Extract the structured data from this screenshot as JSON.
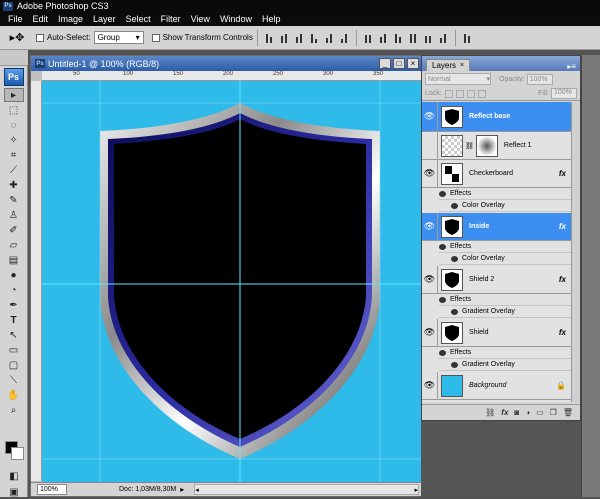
{
  "app": {
    "title": "Adobe Photoshop CS3",
    "logo": "Ps"
  },
  "menu": [
    "File",
    "Edit",
    "Image",
    "Layer",
    "Select",
    "Filter",
    "View",
    "Window",
    "Help"
  ],
  "options": {
    "auto_select_label": "Auto-Select:",
    "auto_select_value": "Group",
    "transform_label": "Show Transform Controls"
  },
  "document": {
    "title": "Untitled-1 @ 100% (RGB/8)",
    "ruler_marks": [
      "50",
      "100",
      "150",
      "200",
      "250",
      "300",
      "350"
    ],
    "canvas_color": "#2ebbea",
    "zoom": "100%",
    "doc_info": "Doc: 1,03M/8,30M"
  },
  "layers_panel": {
    "tab_label": "Layers",
    "tab_close": "×",
    "blend_mode": "Normal",
    "opacity_label": "Opacity:",
    "opacity_value": "100%",
    "lock_label": "Lock:",
    "fill_label": "Fill:",
    "fill_value": "100%",
    "selected_color": "#3c8ef0",
    "layers": [
      {
        "name": "Reflect base",
        "selected": true,
        "fx": false
      },
      {
        "name": "Reflect 1",
        "selected": false,
        "fx": false
      },
      {
        "name": "Checkerboard",
        "selected": false,
        "fx": true,
        "effects_label": "Effects",
        "effects": [
          "Color Overlay"
        ]
      },
      {
        "name": "Inside",
        "selected": true,
        "fx": true,
        "effects_label": "Effects",
        "effects": [
          "Color Overlay"
        ]
      },
      {
        "name": "Shield 2",
        "selected": false,
        "fx": true,
        "effects_label": "Effects",
        "effects": [
          "Gradient Overlay"
        ]
      },
      {
        "name": "Shield",
        "selected": false,
        "fx": true,
        "effects_label": "Effects",
        "effects": [
          "Gradient Overlay"
        ]
      },
      {
        "name": "Background",
        "selected": false,
        "fx": false
      }
    ],
    "fx_symbol": "fx"
  }
}
